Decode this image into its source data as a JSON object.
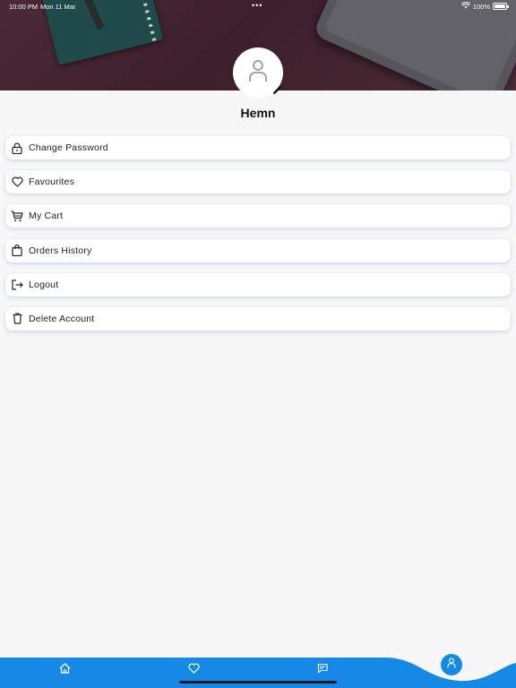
{
  "status_bar": {
    "time": "10:00 PM",
    "date": "Mon 11 Mar",
    "battery": "100%",
    "dots": "•••"
  },
  "profile": {
    "name": "Hemn",
    "avatar_icon": "user-icon",
    "edit_icon": "pencil-icon"
  },
  "menu": {
    "items": [
      {
        "label": "Change Password",
        "icon": "lock-icon"
      },
      {
        "label": "Favourites",
        "icon": "heart-icon"
      },
      {
        "label": "My Cart",
        "icon": "cart-icon"
      },
      {
        "label": "Orders History",
        "icon": "bag-icon"
      },
      {
        "label": "Logout",
        "icon": "logout-icon"
      },
      {
        "label": "Delete Account",
        "icon": "trash-icon"
      }
    ]
  },
  "bottom_nav": {
    "items": [
      {
        "icon": "home-icon",
        "active": false
      },
      {
        "icon": "heart-icon",
        "active": false
      },
      {
        "icon": "chat-icon",
        "active": false
      },
      {
        "icon": "profile-icon",
        "active": true
      }
    ]
  },
  "colors": {
    "accent": "#1688e6",
    "header": "#4a2a36",
    "background": "#f7f7f8"
  }
}
